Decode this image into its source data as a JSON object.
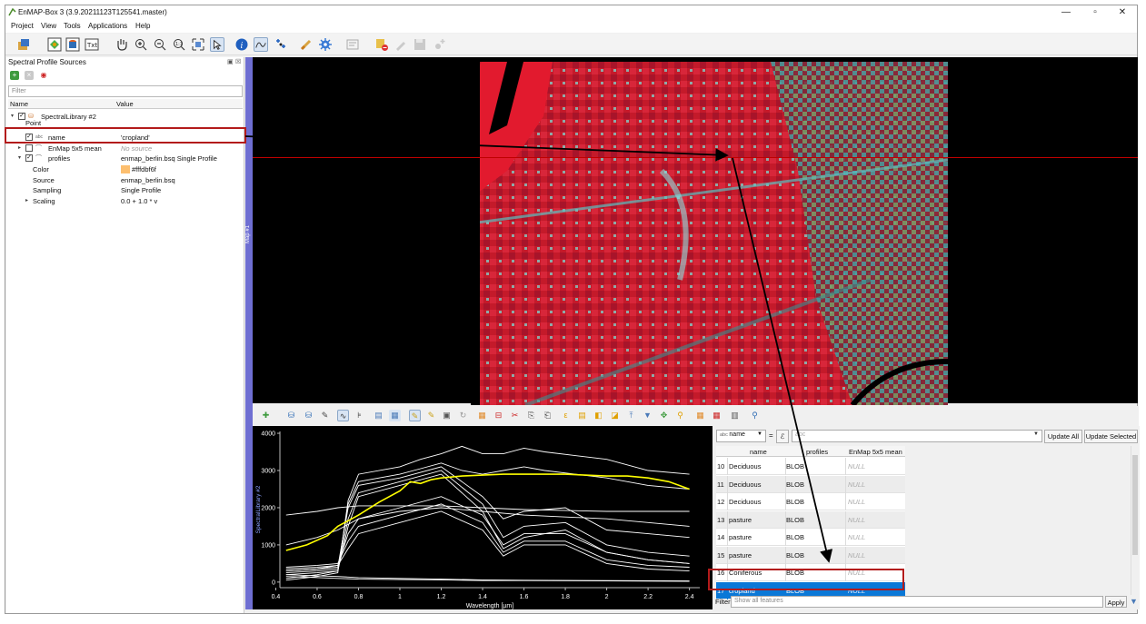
{
  "window": {
    "title": "EnMAP-Box 3 (3.9.20211123T125541.master)",
    "controls": {
      "minimize": "—",
      "maximize": "▫",
      "close": "✕"
    }
  },
  "menubar": [
    "Project",
    "View",
    "Tools",
    "Applications",
    "Help"
  ],
  "toolbar": {
    "icons": [
      "add-data-source-icon",
      "new-map-view-icon",
      "new-spectral-library-icon",
      "new-text-view-icon",
      "pan-icon",
      "zoom-in-icon",
      "zoom-out-icon",
      "zoom-native-icon",
      "zoom-full-icon",
      "select-cursor-icon",
      "identify-icon",
      "spectral-profile-icon",
      "location-icon",
      "link-icon",
      "settings-icon"
    ]
  },
  "left_panel": {
    "title": "Spectral Profile Sources",
    "filter_placeholder": "Filter",
    "columns": [
      "Name",
      "Value"
    ],
    "tree": [
      {
        "indent": 0,
        "arrow": "▾",
        "check": "✓",
        "icon": "db",
        "name": "SpectralLibrary #2",
        "value": ""
      },
      {
        "indent": 1,
        "arrow": "",
        "check": "",
        "icon": "",
        "name": "Point",
        "value": "",
        "partial": true
      },
      {
        "indent": 1,
        "arrow": "",
        "check": "✓",
        "icon": "abc",
        "name": "name",
        "value": "'cropland'",
        "highlight": true
      },
      {
        "indent": 1,
        "arrow": "▸",
        "check": "",
        "icon": "wave",
        "name": "EnMap 5x5 mean",
        "value": "No source",
        "value_italic": true
      },
      {
        "indent": 1,
        "arrow": "▾",
        "check": "✓",
        "icon": "wave",
        "name": "profiles",
        "value": "enmap_berlin.bsq Single Profile"
      },
      {
        "indent": 2,
        "arrow": "",
        "check": "",
        "icon": "",
        "name": "Color",
        "value": "#fffdbf6f",
        "swatch": "#fdbf6f"
      },
      {
        "indent": 2,
        "arrow": "",
        "check": "",
        "icon": "",
        "name": "Source",
        "value": "enmap_berlin.bsq"
      },
      {
        "indent": 2,
        "arrow": "",
        "check": "",
        "icon": "",
        "name": "Sampling",
        "value": "Single Profile"
      },
      {
        "indent": 2,
        "arrow": "▸",
        "check": "",
        "icon": "",
        "name": "Scaling",
        "value": "0.0 + 1.0 * v"
      }
    ]
  },
  "map": {
    "tab_label": "Map #1",
    "crosshair_color": "#c00000"
  },
  "spectral_library": {
    "tab_label": "SpectralLibrary #2",
    "field_combo": "name",
    "expression_value": "abc",
    "update_all": "Update All",
    "update_selected": "Update Selected",
    "columns": [
      "name",
      "profiles",
      "EnMap 5x5 mean"
    ],
    "rows": [
      {
        "id": "10",
        "name": "Deciduous",
        "profiles": "BLOB",
        "mean": "NULL"
      },
      {
        "id": "11",
        "name": "Deciduous",
        "profiles": "BLOB",
        "mean": "NULL"
      },
      {
        "id": "12",
        "name": "Deciduous",
        "profiles": "BLOB",
        "mean": "NULL"
      },
      {
        "id": "13",
        "name": "pasture",
        "profiles": "BLOB",
        "mean": "NULL"
      },
      {
        "id": "14",
        "name": "pasture",
        "profiles": "BLOB",
        "mean": "NULL"
      },
      {
        "id": "15",
        "name": "pasture",
        "profiles": "BLOB",
        "mean": "NULL"
      },
      {
        "id": "16",
        "name": "Coniferous",
        "profiles": "BLOB",
        "mean": "NULL"
      },
      {
        "id": "17",
        "name": "cropland",
        "profiles": "BLOB",
        "mean": "NULL",
        "selected": true
      }
    ],
    "filter_label": "Filter",
    "filter_placeholder": "Show all features",
    "apply": "Apply"
  },
  "chart_data": {
    "type": "line",
    "xlabel": "Wavelength [µm]",
    "ylabel": "",
    "xlim": [
      0.42,
      2.45
    ],
    "ylim": [
      -150,
      4050
    ],
    "xticks": [
      "0.4",
      "0.6",
      "0.8",
      "1",
      "1.2",
      "1.4",
      "1.6",
      "1.8",
      "2",
      "2.2",
      "2.4"
    ],
    "yticks": [
      "0",
      "1000",
      "2000",
      "3000",
      "4000"
    ],
    "current_profile_color": "#ffff00",
    "library_profile_color": "#ffffff",
    "series": [
      {
        "highlight": true,
        "x": [
          0.45,
          0.55,
          0.65,
          0.7,
          0.75,
          0.8,
          0.9,
          1.0,
          1.05,
          1.1,
          1.15,
          1.2,
          1.3,
          1.5,
          1.6,
          1.7,
          1.8,
          2.0,
          2.1,
          2.2,
          2.3,
          2.4
        ],
        "y": [
          850,
          1000,
          1250,
          1500,
          1650,
          1800,
          2150,
          2450,
          2700,
          2650,
          2750,
          2800,
          2850,
          2900,
          2900,
          2900,
          2900,
          2850,
          2850,
          2800,
          2700,
          2500
        ]
      },
      {
        "x": [
          0.45,
          0.6,
          0.7,
          0.75,
          0.8,
          1.0,
          1.1,
          1.2,
          1.3,
          1.4,
          1.5,
          1.6,
          1.7,
          2.0,
          2.2,
          2.4
        ],
        "y": [
          50,
          150,
          250,
          2200,
          2900,
          3100,
          3300,
          3450,
          3650,
          3450,
          3450,
          3600,
          3500,
          3300,
          3000,
          2900
        ]
      },
      {
        "x": [
          0.45,
          0.6,
          0.7,
          0.75,
          0.8,
          1.0,
          1.1,
          1.2,
          1.3,
          1.4,
          1.5,
          1.6,
          1.7,
          2.0,
          2.2,
          2.4
        ],
        "y": [
          100,
          200,
          300,
          2100,
          2700,
          2900,
          3050,
          3200,
          3000,
          2900,
          3000,
          3100,
          3000,
          2800,
          2600,
          2500
        ]
      },
      {
        "x": [
          0.45,
          0.6,
          0.7,
          0.75,
          0.8,
          1.0,
          1.2,
          1.4,
          1.5,
          1.6,
          1.8,
          2.0,
          2.2,
          2.4
        ],
        "y": [
          300,
          350,
          400,
          2000,
          2600,
          2800,
          3100,
          2300,
          1700,
          1900,
          2000,
          1400,
          1300,
          1200
        ]
      },
      {
        "x": [
          0.45,
          0.6,
          0.7,
          0.75,
          0.8,
          1.0,
          1.2,
          1.4,
          1.5,
          1.6,
          1.8,
          2.0,
          2.2,
          2.4
        ],
        "y": [
          250,
          300,
          350,
          1700,
          2400,
          2700,
          3000,
          2100,
          1200,
          1500,
          1600,
          1000,
          800,
          700
        ]
      },
      {
        "x": [
          0.45,
          0.6,
          0.7,
          0.75,
          0.8,
          1.0,
          1.2,
          1.4,
          1.5,
          1.6,
          1.8,
          2.0,
          2.2,
          2.4
        ],
        "y": [
          200,
          250,
          300,
          1500,
          2300,
          2600,
          2900,
          1900,
          900,
          1200,
          1400,
          800,
          600,
          500
        ]
      },
      {
        "x": [
          0.45,
          0.6,
          0.7,
          0.75,
          0.8,
          1.0,
          1.2,
          1.4,
          1.5,
          1.6,
          1.8,
          2.0,
          2.2,
          2.4
        ],
        "y": [
          350,
          400,
          450,
          1300,
          1700,
          2000,
          2300,
          1800,
          1000,
          1300,
          1300,
          800,
          600,
          500
        ]
      },
      {
        "x": [
          0.45,
          0.6,
          0.7,
          0.75,
          0.8,
          1.0,
          1.2,
          1.4,
          1.5,
          1.6,
          1.8,
          2.0,
          2.2,
          2.4
        ],
        "y": [
          400,
          450,
          500,
          1100,
          1500,
          1800,
          2100,
          1600,
          800,
          1100,
          1100,
          600,
          450,
          400
        ]
      },
      {
        "x": [
          0.45,
          0.6,
          0.7,
          0.75,
          0.8,
          1.0,
          1.2,
          1.4,
          1.5,
          1.6,
          1.8,
          2.0,
          2.2,
          2.4
        ],
        "y": [
          300,
          350,
          450,
          900,
          1300,
          1600,
          1900,
          1400,
          700,
          1000,
          1000,
          500,
          350,
          300
        ]
      },
      {
        "x": [
          0.45,
          0.6,
          0.7,
          0.8,
          1.0,
          1.2,
          1.4,
          1.6,
          2.0,
          2.4
        ],
        "y": [
          1000,
          1200,
          1400,
          1700,
          1900,
          2000,
          1900,
          1800,
          1700,
          1500
        ]
      },
      {
        "x": [
          0.45,
          0.6,
          0.7,
          0.8,
          1.0,
          1.2,
          1.4,
          1.6,
          2.0,
          2.4
        ],
        "y": [
          1800,
          1900,
          2000,
          2050,
          2050,
          2050,
          2000,
          1950,
          1900,
          1900
        ]
      },
      {
        "x": [
          0.45,
          0.6,
          0.7,
          0.8,
          1.0,
          1.2,
          1.4,
          1.6,
          2.0,
          2.4
        ],
        "y": [
          150,
          120,
          100,
          80,
          70,
          60,
          40,
          40,
          30,
          20
        ]
      },
      {
        "x": [
          0.45,
          0.6,
          0.7,
          0.8,
          1.0,
          1.2,
          1.4,
          1.6,
          2.0,
          2.4
        ],
        "y": [
          200,
          170,
          150,
          120,
          100,
          80,
          60,
          50,
          40,
          30
        ]
      }
    ]
  },
  "annotations": {
    "box_color": "#b31b1b",
    "arrow_color": "#000000"
  }
}
